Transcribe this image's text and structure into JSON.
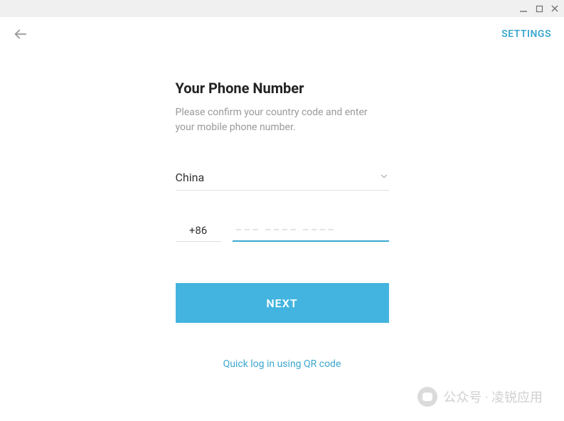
{
  "header": {
    "settings_label": "SETTINGS"
  },
  "form": {
    "title": "Your Phone Number",
    "subtitle": "Please confirm your country code and enter your mobile phone number.",
    "country": "China",
    "code_value": "+86",
    "phone_placeholder": "––– –––– ––––",
    "next_label": "NEXT",
    "qr_link": "Quick log in using QR code"
  },
  "watermark": {
    "text": "公众号 · 凌锐应用"
  }
}
